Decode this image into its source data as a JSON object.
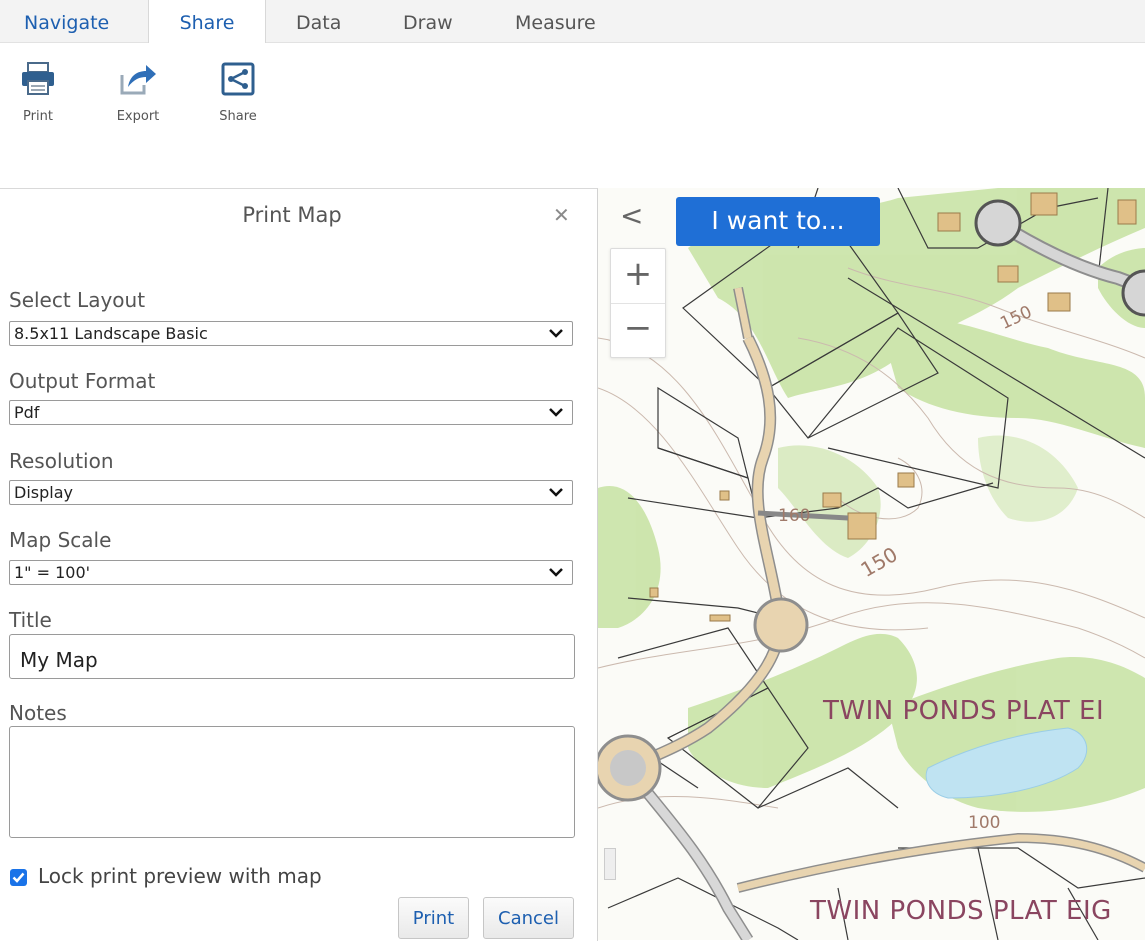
{
  "tabs": [
    {
      "label": "Navigate"
    },
    {
      "label": "Share"
    },
    {
      "label": "Data"
    },
    {
      "label": "Draw"
    },
    {
      "label": "Measure"
    }
  ],
  "active_tab": "Share",
  "ribbon": {
    "print_label": "Print",
    "export_label": "Export",
    "share_label": "Share"
  },
  "panel": {
    "title": "Print Map",
    "close_icon": "close-icon",
    "layout": {
      "label": "Select Layout",
      "value": "8.5x11 Landscape Basic"
    },
    "format": {
      "label": "Output Format",
      "value": "Pdf"
    },
    "resolution": {
      "label": "Resolution",
      "value": "Display"
    },
    "scale": {
      "label": "Map Scale",
      "value": "1\" = 100'"
    },
    "title_field": {
      "label": "Title",
      "value": "My Map"
    },
    "notes_field": {
      "label": "Notes",
      "value": ""
    },
    "lock_label": "Lock print preview with map",
    "lock_checked": true,
    "print_button": "Print",
    "cancel_button": "Cancel"
  },
  "map": {
    "i_want_to": "I want to...",
    "zoom_in": "+",
    "zoom_out": "−",
    "back": "<",
    "labels": {
      "twin_ponds_1": "TWIN PONDS PLAT EI",
      "twin_ponds_2": "TWIN PONDS PLAT EIG",
      "c150a": "150",
      "c150b": "150",
      "c160": "160",
      "c100": "100"
    }
  },
  "colors": {
    "accent": "#1f6fd6",
    "link": "#1d5fb0",
    "vegetation": "#c6e3a3",
    "water": "#bfe3f2",
    "parcel_label": "#8a4560"
  }
}
